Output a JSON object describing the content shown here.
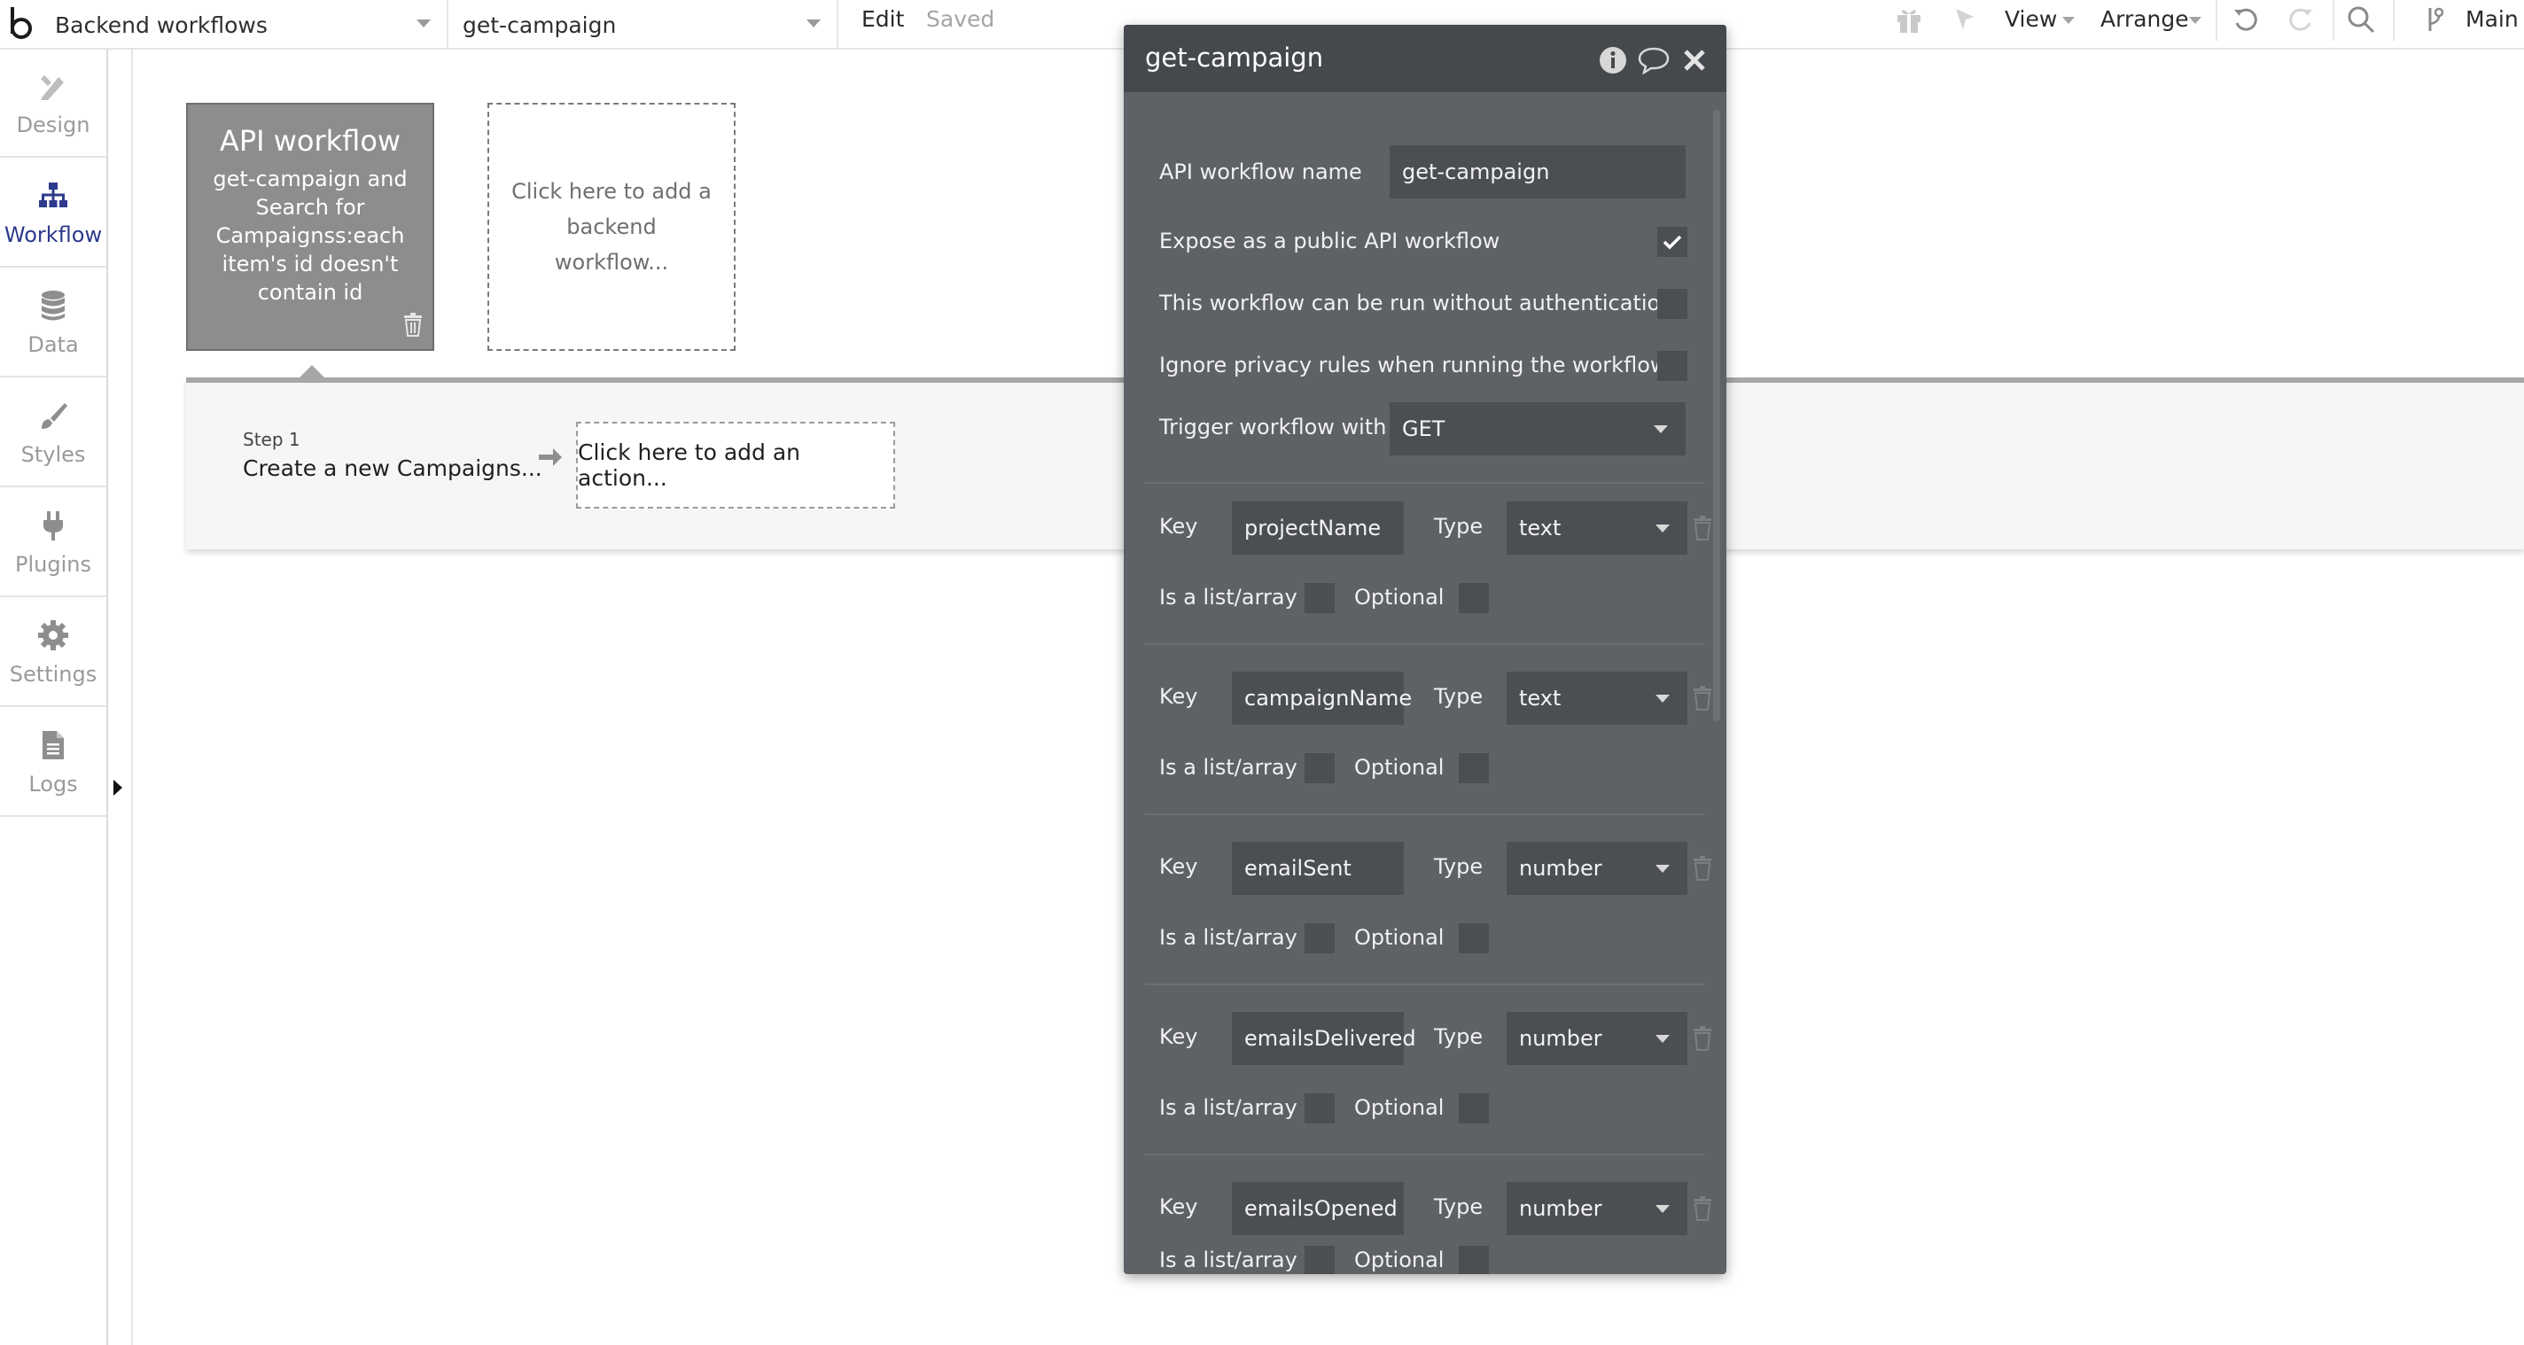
{
  "topbar": {
    "page_select": "Backend workflows",
    "element_select": "get-campaign",
    "edit": "Edit",
    "saved": "Saved",
    "view": "View",
    "arrange": "Arrange",
    "branch": "Main"
  },
  "sidebar": {
    "items": [
      {
        "label": "Design"
      },
      {
        "label": "Workflow"
      },
      {
        "label": "Data"
      },
      {
        "label": "Styles"
      },
      {
        "label": "Plugins"
      },
      {
        "label": "Settings"
      },
      {
        "label": "Logs"
      }
    ]
  },
  "canvas": {
    "api_card_title": "API workflow",
    "api_card_desc": "get-campaign and Search for Campaignss:each item's id doesn't contain id",
    "add_card": "Click here to add a backend workflow...",
    "step_label": "Step 1",
    "step_name": "Create a new Campaigns...",
    "add_action": "Click here to add an action..."
  },
  "panel": {
    "title": "get-campaign",
    "name_label": "API workflow name",
    "name_value": "get-campaign",
    "expose_label": "Expose as a public API workflow",
    "expose_checked": true,
    "noauth_label": "This workflow can be run without authentication",
    "privacy_label": "Ignore privacy rules when running the workflow",
    "trigger_label": "Trigger workflow with",
    "trigger_value": "GET",
    "key_label": "Key",
    "type_label": "Type",
    "list_label": "Is a list/array",
    "optional_label": "Optional",
    "params": [
      {
        "key": "projectName",
        "type": "text"
      },
      {
        "key": "campaignName",
        "type": "text"
      },
      {
        "key": "emailSent",
        "type": "number"
      },
      {
        "key": "emailsDelivered",
        "type": "number"
      },
      {
        "key": "emailsOpened",
        "type": "number"
      }
    ]
  },
  "colors": {
    "accent": "#2d3a8c",
    "panel_bg": "#5e6165",
    "panel_header": "#45484c"
  }
}
